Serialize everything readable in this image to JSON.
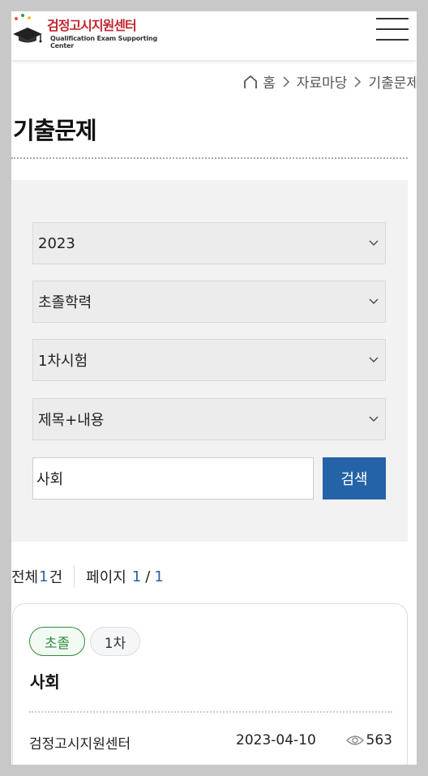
{
  "header": {
    "logo_kr": "검정고시지원센터",
    "logo_en": "Qualification Exam Supporting Center"
  },
  "breadcrumb": {
    "home": "홈",
    "section": "자료마당",
    "current": "기출문제"
  },
  "page": {
    "title": "기출문제"
  },
  "filters": {
    "year": "2023",
    "level": "초졸학력",
    "round": "1차시험",
    "search_field": "제목+내용",
    "keyword": "사회",
    "search_button": "검색"
  },
  "summary": {
    "total_prefix": "전체",
    "total_count": "1",
    "total_suffix": "건",
    "page_label": "페이지",
    "current_page": "1",
    "page_divider": "/",
    "total_pages": "1"
  },
  "results": [
    {
      "level_badge": "초졸",
      "round_badge": "1차",
      "title": "사회",
      "author": "검정고시지원센터",
      "date": "2023-04-10",
      "views": "563"
    }
  ],
  "colors": {
    "accent": "#2563a8",
    "badge_green": "#2e8b3c",
    "filter_bg": "#f2f2f2"
  },
  "icons": [
    "home-icon",
    "chevron-right-icon",
    "chevron-down-icon",
    "hamburger-menu-icon",
    "eye-icon"
  ]
}
